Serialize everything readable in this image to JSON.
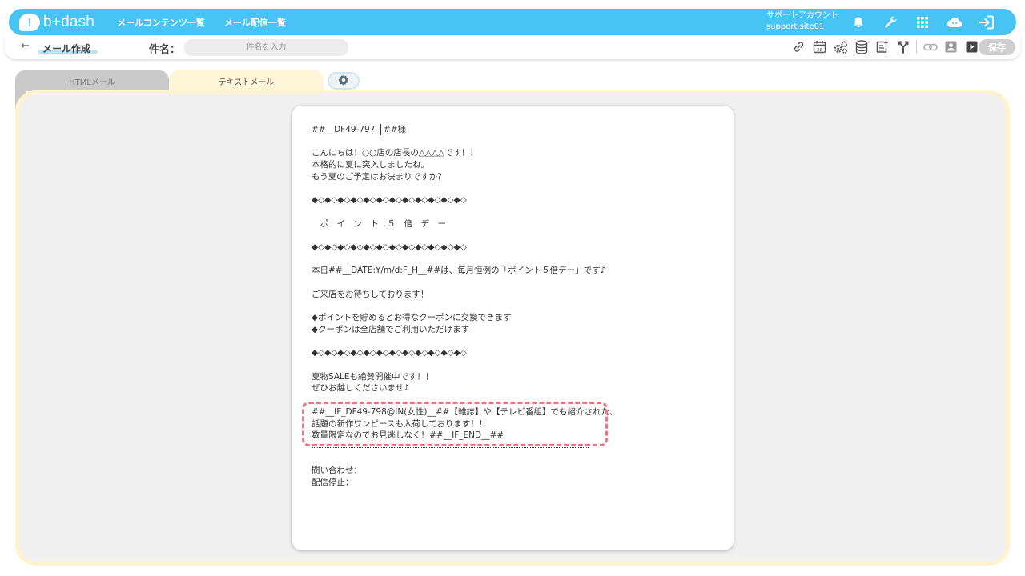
{
  "app": {
    "logo_text": "b+dash",
    "logo_mark": "!",
    "nav": [
      "メールコンテンツ一覧",
      "メール配信一覧"
    ],
    "account_label": "サポートアカウント",
    "account_site": "support.site01",
    "top_icons": [
      "bell-icon",
      "wrench-icon",
      "grid-icon",
      "cloud-icon",
      "logout-icon"
    ]
  },
  "subbar": {
    "back_icon": "←",
    "page_title": "メール作成",
    "subject_label": "件名：",
    "subject_placeholder": "件名を入力",
    "subject_value": "",
    "tools": [
      "link-icon",
      "calendar-icon",
      "gears-icon",
      "database-icon",
      "add-document-icon",
      "branch-icon",
      "link-disabled-icon",
      "contact-icon",
      "play-icon"
    ],
    "save_label": "保存"
  },
  "tabs": {
    "html": "HTMLメール",
    "text": "テキストメール",
    "settings_icon": "gear-icon"
  },
  "editor": {
    "body": "##__DF49-797__##様\n\nこんにちは！○○店の店長の△△△△です！！\n本格的に夏に突入しましたね。\nもう夏のご予定はお決まりですか？\n\n◆◇◆◇◆◇◆◇◆◇◆◇◆◇◆◇◆◇◆◇◆◇◆◇\n\n　ポ　イ　ン　ト　５　倍　デ　ー\n\n◆◇◆◇◆◇◆◇◆◇◆◇◆◇◆◇◆◇◆◇◆◇◆◇\n\n本日##__DATE:Y/m/d:F_H__##は、毎月恒例の「ポイント５倍デー」です♪\n\nご来店をお待ちしております！\n\n◆ポイントを貯めるとお得なクーポンに交換できます\n◆クーポンは全店舗でご利用いただけます\n\n◆◇◆◇◆◇◆◇◆◇◆◇◆◇◆◇◆◇◆◇◆◇◆◇\n\n夏物SALEも絶賛開催中です！！\nぜひお越しくださいませ♪\n\n##__IF_DF49-798@IN(女性)__##【雑誌】や【テレビ番組】でも紹介された、\n話題の新作ワンピースも入荷しております！！\n数量限定なのでお見逃しなく！##__IF_END__##\n\n\n問い合わせ：\n配信停止："
  },
  "colors": {
    "header": "#48c4f4",
    "tab_active": "#fff5d9",
    "panel_border": "#fff2cc",
    "highlight": "#ea7784"
  }
}
